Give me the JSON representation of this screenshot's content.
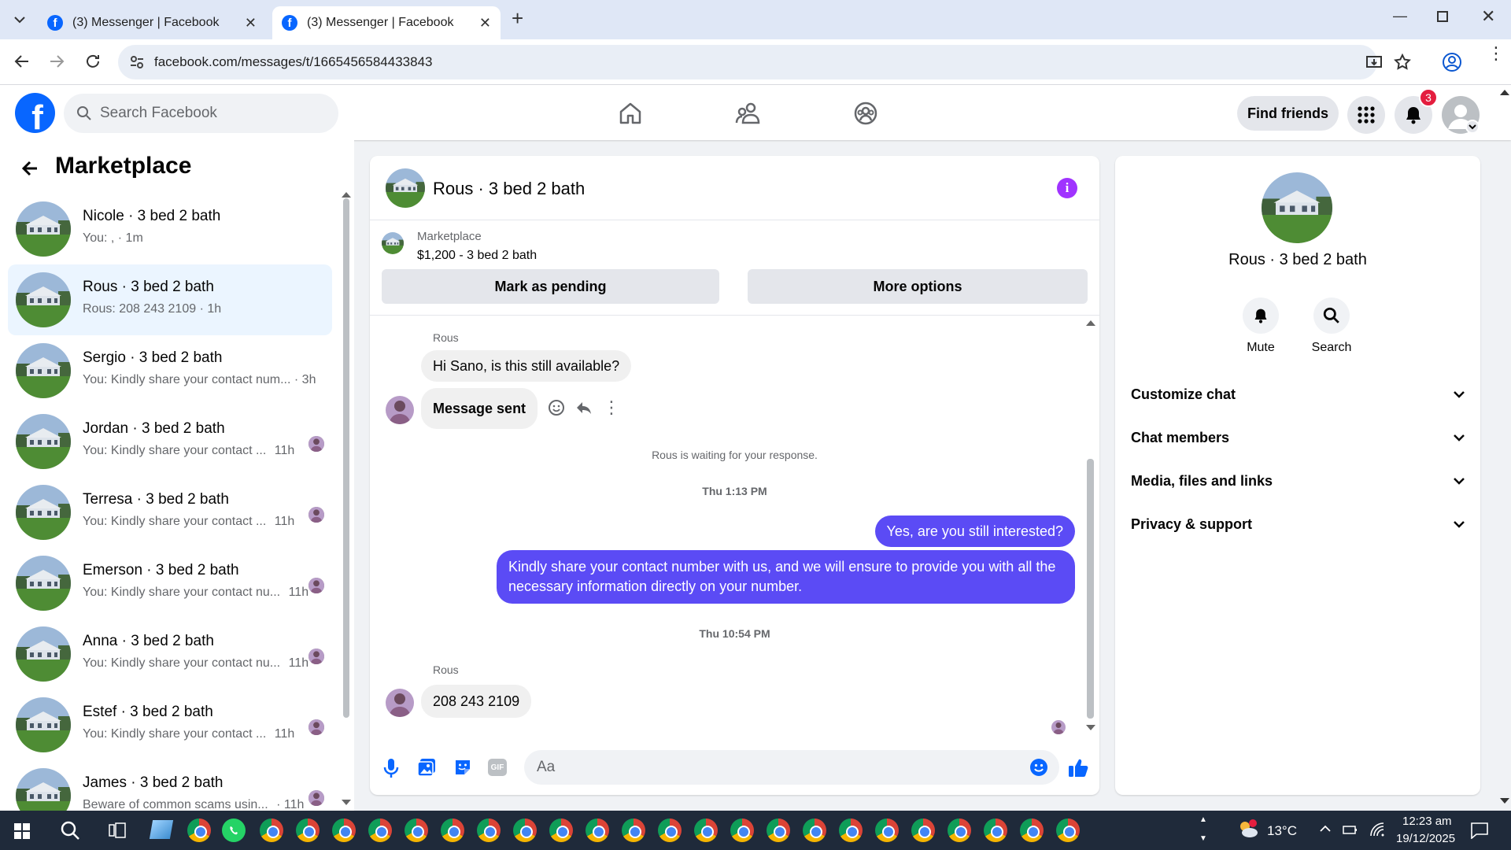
{
  "browser": {
    "tabs": [
      {
        "title": "(3) Messenger | Facebook",
        "active": false
      },
      {
        "title": "(3) Messenger | Facebook",
        "active": true
      }
    ],
    "new_tab_icon": "plus-icon",
    "url": "facebook.com/messages/t/1665456584433843"
  },
  "fb_header": {
    "logo": "f",
    "search_placeholder": "Search Facebook",
    "find_friends_label": "Find friends",
    "notification_count": "3"
  },
  "sidebar": {
    "title": "Marketplace",
    "conversations": [
      {
        "name": "Nicole · 3 bed 2 bath",
        "preview": "You: , · 1m",
        "time": "",
        "selected": false
      },
      {
        "name": "Rous · 3 bed 2 bath",
        "preview": "Rous: 208 243 2109 · 1h",
        "time": "",
        "selected": true
      },
      {
        "name": "Sergio · 3 bed 2 bath",
        "preview": "You: Kindly share your contact num... · 3h",
        "time": "",
        "selected": false
      },
      {
        "name": "Jordan · 3 bed 2 bath",
        "preview": "You: Kindly share your contact ...",
        "time": "11h",
        "selected": false
      },
      {
        "name": "Terresa · 3 bed 2 bath",
        "preview": "You: Kindly share your contact ...",
        "time": "11h",
        "selected": false
      },
      {
        "name": "Emerson · 3 bed 2 bath",
        "preview": "You: Kindly share your contact nu...",
        "time": "11h",
        "selected": false
      },
      {
        "name": "Anna · 3 bed 2 bath",
        "preview": "You: Kindly share your contact nu...",
        "time": "11h",
        "selected": false
      },
      {
        "name": "Estef · 3 bed 2 bath",
        "preview": "You: Kindly share your contact ...",
        "time": "11h",
        "selected": false
      },
      {
        "name": "James · 3 bed 2 bath",
        "preview": "Beware of common scams usin...",
        "time": "· 11h",
        "selected": false
      }
    ]
  },
  "chat": {
    "title": "Rous · 3 bed 2 bath",
    "listing_source": "Marketplace",
    "listing_title": "$1,200 - 3 bed 2 bath",
    "mark_pending_label": "Mark as pending",
    "more_options_label": "More options",
    "messages": {
      "sender1": "Rous",
      "in1": "Hi Sano, is this still available?",
      "in2": "Message sent",
      "waiting": "Rous is waiting for your response.",
      "time1": "Thu 1:13 PM",
      "out1": "Yes, are you still interested?",
      "out2": "Kindly share your contact number with us, and we will ensure to provide you with all the necessary information directly on your number.",
      "time2": "Thu 10:54 PM",
      "sender2": "Rous",
      "in3": "208 243 2109"
    },
    "composer_placeholder": "Aa"
  },
  "details": {
    "name": "Rous · 3 bed 2 bath",
    "actions": [
      {
        "label": "Mute",
        "icon": "bell-icon"
      },
      {
        "label": "Search",
        "icon": "search-icon"
      }
    ],
    "sections": [
      "Customize chat",
      "Chat members",
      "Media, files and links",
      "Privacy & support"
    ]
  },
  "taskbar": {
    "temperature": "13°C",
    "time": "12:23 am",
    "date": "19/12/2025"
  },
  "colors": {
    "fb_blue": "#0866ff",
    "outgoing_bubble": "#5b4bf5",
    "selected_row": "#ebf5ff",
    "info_purple": "#a033ff",
    "badge_red": "#e41e3f"
  }
}
